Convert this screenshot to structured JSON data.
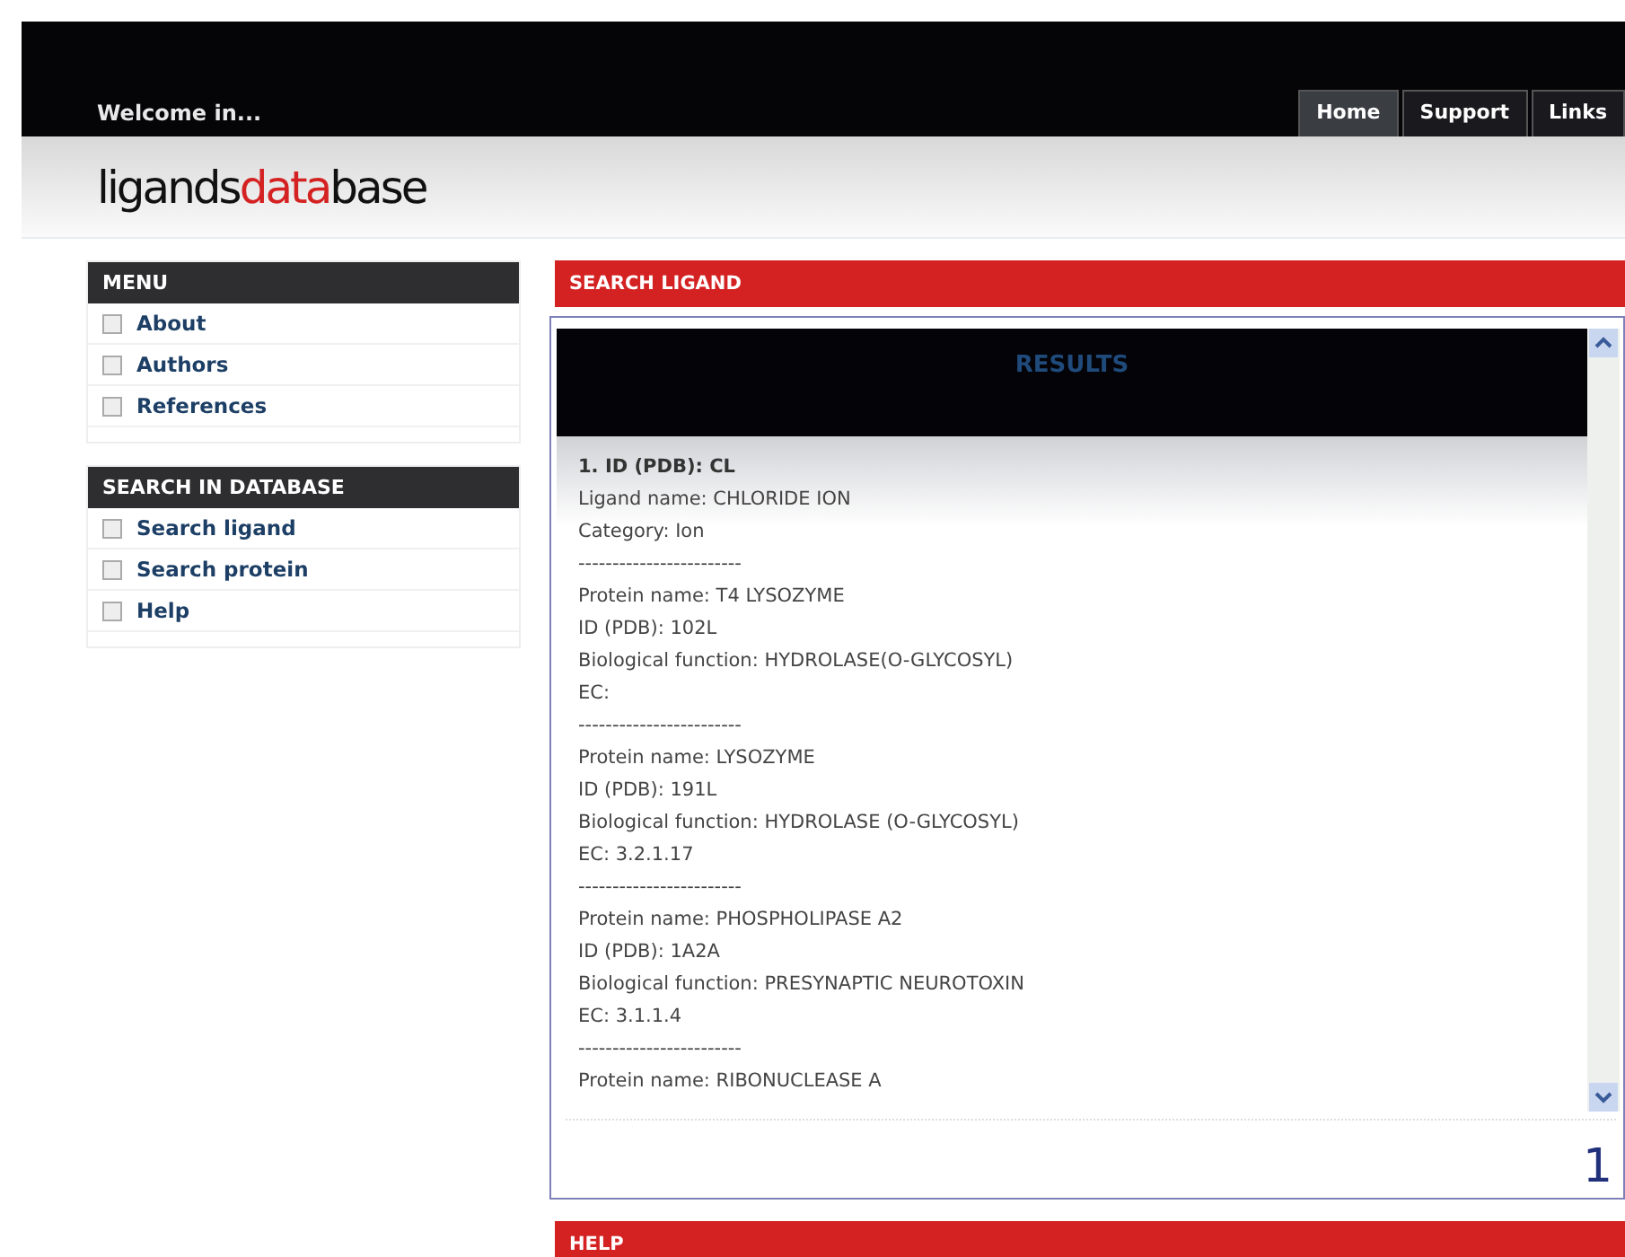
{
  "header": {
    "welcome": "Welcome in...",
    "tabs": [
      {
        "label": "Home",
        "selected": true
      },
      {
        "label": "Support",
        "selected": false
      },
      {
        "label": "Links",
        "selected": false
      }
    ]
  },
  "logo": [
    {
      "text": "ligands",
      "highlight": false
    },
    {
      "text": "data",
      "highlight": true
    },
    {
      "text": "base",
      "highlight": false
    }
  ],
  "sidebar": [
    {
      "title": "MENU",
      "items": [
        "About",
        "Authors",
        "References"
      ]
    },
    {
      "title": "SEARCH IN DATABASE",
      "items": [
        "Search ligand",
        "Search protein",
        "Help"
      ]
    }
  ],
  "main": {
    "title": "SEARCH LIGAND",
    "results_title": "RESULTS",
    "lines": [
      {
        "kind": "heading",
        "text": "1. ID (PDB): CL"
      },
      {
        "kind": "text",
        "text": "Ligand name: CHLORIDE ION"
      },
      {
        "kind": "text",
        "text": "Category: Ion"
      },
      {
        "kind": "text",
        "text": "------------------------"
      },
      {
        "kind": "text",
        "text": "Protein name: T4 LYSOZYME"
      },
      {
        "kind": "text",
        "text": "ID (PDB): 102L"
      },
      {
        "kind": "text",
        "text": "Biological function: HYDROLASE(O-GLYCOSYL)"
      },
      {
        "kind": "text",
        "text": "EC:"
      },
      {
        "kind": "text",
        "text": "------------------------"
      },
      {
        "kind": "text",
        "text": "Protein name: LYSOZYME"
      },
      {
        "kind": "text",
        "text": "ID (PDB): 191L"
      },
      {
        "kind": "text",
        "text": "Biological function: HYDROLASE (O-GLYCOSYL)"
      },
      {
        "kind": "text",
        "text": "EC: 3.2.1.17"
      },
      {
        "kind": "text",
        "text": "------------------------"
      },
      {
        "kind": "text",
        "text": "Protein name: PHOSPHOLIPASE A2"
      },
      {
        "kind": "text",
        "text": "ID (PDB): 1A2A"
      },
      {
        "kind": "text",
        "text": "Biological function: PRESYNAPTIC NEUROTOXIN"
      },
      {
        "kind": "text",
        "text": "EC: 3.1.1.4"
      },
      {
        "kind": "text",
        "text": "------------------------"
      },
      {
        "kind": "text",
        "text": "Protein name: RIBONUCLEASE A"
      }
    ],
    "page": "1"
  },
  "help": {
    "title": "HELP"
  }
}
